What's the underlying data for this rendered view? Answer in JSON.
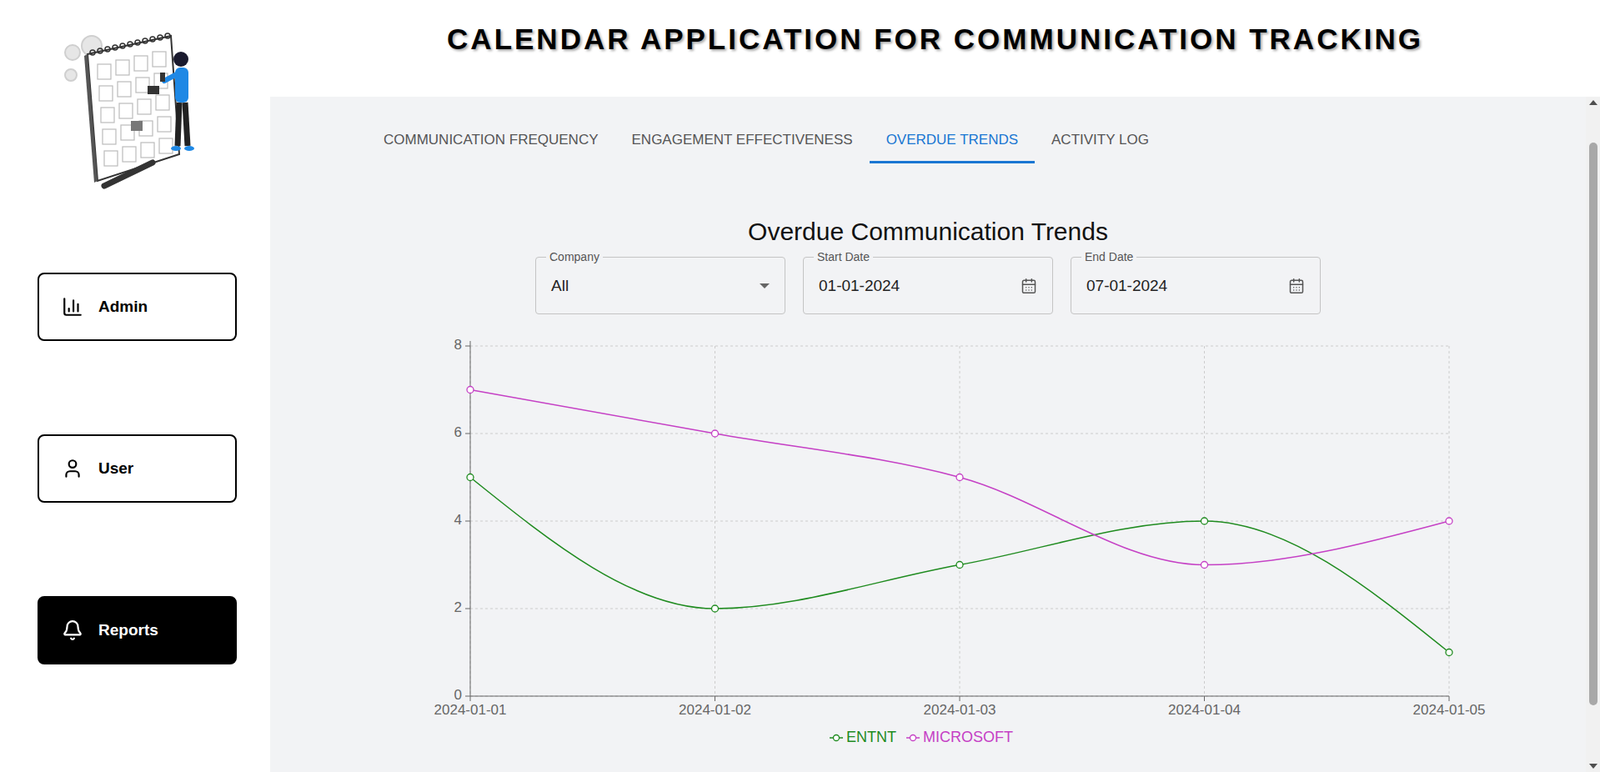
{
  "header": {
    "title": "CALENDAR APPLICATION FOR COMMUNICATION TRACKING"
  },
  "sidebar": {
    "items": [
      {
        "label": "Admin",
        "icon": "chart",
        "selected": false
      },
      {
        "label": "User",
        "icon": "user",
        "selected": false
      },
      {
        "label": "Reports",
        "icon": "bell",
        "selected": true
      }
    ]
  },
  "tabs": [
    {
      "label": "COMMUNICATION FREQUENCY",
      "selected": false
    },
    {
      "label": "ENGAGEMENT EFFECTIVENESS",
      "selected": false
    },
    {
      "label": "OVERDUE TRENDS",
      "selected": true
    },
    {
      "label": "ACTIVITY LOG",
      "selected": false
    }
  ],
  "chart": {
    "title": "Overdue Communication Trends",
    "filters": [
      {
        "label": "Company",
        "value": "All",
        "kind": "select"
      },
      {
        "label": "Start Date",
        "value": "01-01-2024",
        "kind": "date"
      },
      {
        "label": "End Date",
        "value": "07-01-2024",
        "kind": "date"
      }
    ],
    "y_max": 8,
    "y_ticks": [
      "0",
      "2",
      "4",
      "6",
      "8"
    ],
    "x_labels": [
      "2024-01-01",
      "2024-01-02",
      "2024-01-03",
      "2024-01-04",
      "2024-01-05"
    ],
    "series": [
      {
        "name": "ENTNT",
        "color": "#1f8b1f",
        "values": [
          5,
          2,
          3,
          4,
          1
        ]
      },
      {
        "name": "MICROSOFT",
        "color": "#c540c5",
        "values": [
          7,
          6,
          5,
          3,
          4
        ]
      }
    ]
  }
}
